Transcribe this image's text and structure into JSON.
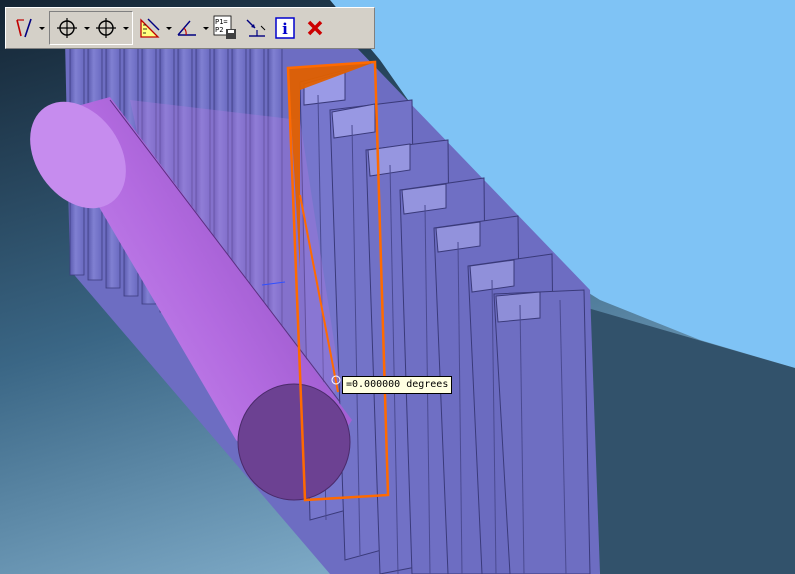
{
  "toolbar": {
    "buttons": [
      {
        "name": "sketch-tool",
        "icon": "pen-line-icon",
        "has_dropdown": true
      },
      {
        "name": "point-tool-1",
        "icon": "crosshair-icon",
        "has_dropdown": true
      },
      {
        "name": "point-tool-2",
        "icon": "crosshair-icon",
        "has_dropdown": true
      },
      {
        "name": "measure-tool",
        "icon": "ruler-triangle-icon",
        "has_dropdown": true
      },
      {
        "name": "angle-tool",
        "icon": "angle-icon",
        "has_dropdown": true
      },
      {
        "name": "save-points",
        "icon": "p1-p2-save-icon",
        "labels": [
          "P1=",
          "P2"
        ]
      },
      {
        "name": "snap-tool",
        "icon": "snap-arrow-icon"
      },
      {
        "name": "info",
        "icon": "info-icon",
        "label": "i"
      },
      {
        "name": "close",
        "icon": "close-icon"
      }
    ]
  },
  "measurement": {
    "readout": "=0.000000 degrees"
  },
  "colors": {
    "background_dark": "#1f3344",
    "background_sky": "#7fc3f5",
    "gear_face": "#7a7acd",
    "gear_dark": "#5a5aa8",
    "cylinder": "#c47fe8",
    "cylinder_end": "#6a3f8e",
    "highlight": "#ff6a00",
    "toolbar": "#d4d0c8",
    "close_red": "#cc0000",
    "info_blue": "#0000cc"
  }
}
